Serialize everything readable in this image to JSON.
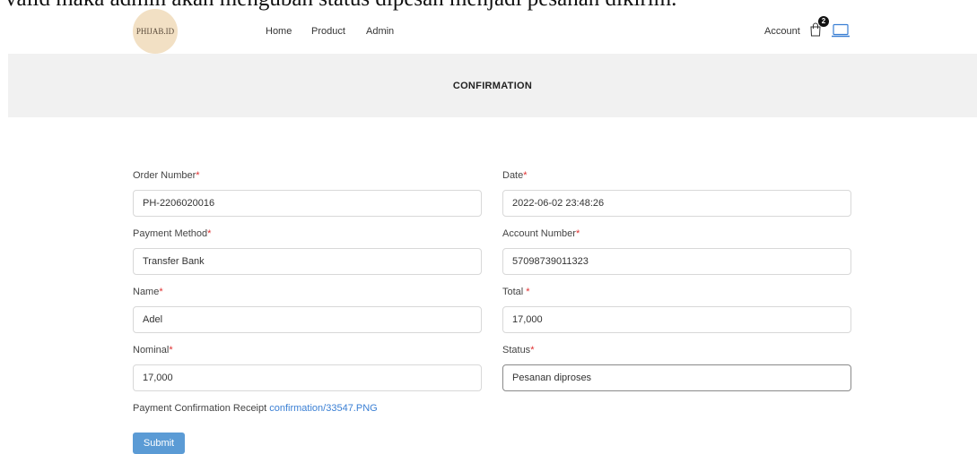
{
  "document": {
    "caption": "valid maka admin akan mengubah status dipesan menjadi pesanan dikirim."
  },
  "nav": {
    "logo_text": "PHIJAB.ID",
    "links": [
      "Home",
      "Product",
      "Admin"
    ],
    "account_label": "Account",
    "cart_count": "2",
    "icons": [
      "shopping-bag-icon",
      "laptop-icon"
    ]
  },
  "banner": {
    "title": "CONFIRMATION"
  },
  "form": {
    "required_marker": "*",
    "order_number": {
      "label": "Order Number",
      "value": "PH-2206020016"
    },
    "date": {
      "label": "Date",
      "value": "2022-06-02 23:48:26"
    },
    "payment_method": {
      "label": "Payment Method",
      "value": "Transfer Bank"
    },
    "account_number": {
      "label": "Account Number",
      "value": "57098739011323"
    },
    "name": {
      "label": "Name",
      "value": "Adel"
    },
    "total": {
      "label": "Total ",
      "value": "17,000"
    },
    "nominal": {
      "label": "Nominal",
      "value": "17,000"
    },
    "status": {
      "label": "Status",
      "value": "Pesanan diproses"
    },
    "receipt": {
      "label": "Payment Confirmation Receipt",
      "link": "confirmation/33547.PNG"
    },
    "submit_label": "Submit"
  },
  "colors": {
    "accent": "#5b9bd5",
    "link": "#3a7fd4",
    "required": "#e03030",
    "banner_bg": "#f1f1f1"
  }
}
